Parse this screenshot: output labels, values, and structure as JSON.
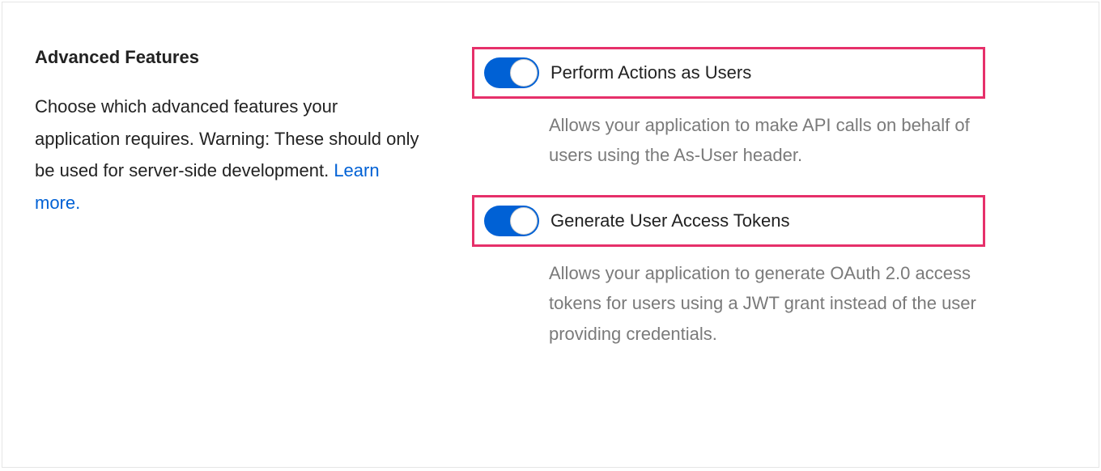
{
  "section": {
    "title": "Advanced Features",
    "desc_part1": "Choose which advanced features your application requires. Warning: These should only be used for server-side development. ",
    "learn_more": "Learn more."
  },
  "features": [
    {
      "label": "Perform Actions as Users",
      "desc": "Allows your application to make API calls on behalf of users using the As-User header.",
      "enabled": true
    },
    {
      "label": "Generate User Access Tokens",
      "desc": "Allows your application to generate OAuth 2.0 access tokens for users using a JWT grant instead of the user providing credentials.",
      "enabled": true
    }
  ]
}
